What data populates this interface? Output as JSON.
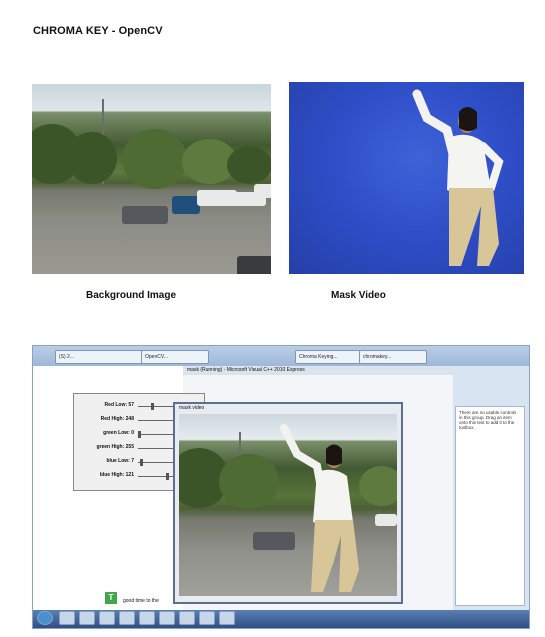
{
  "page": {
    "title": "CHROMA KEY - OpenCV"
  },
  "figures": {
    "background_caption": "Background Image",
    "mask_caption": "Mask Video"
  },
  "screenshot": {
    "browser_tabs": [
      "(S) 2...",
      "OpenCV...",
      "Chroma Keying...",
      "chromakey..."
    ],
    "vs_title": "mask (Running) - Microsoft Visual C++ 2010 Express",
    "slider_labels": [
      "Red Low: 57",
      "Red High: 248",
      "green Low: 0",
      "green High: 255",
      "blue Low: 7",
      "blue High: 121"
    ],
    "slider_levels": [
      0.22,
      0.97,
      0.0,
      1.0,
      0.03,
      0.47
    ],
    "toolbox_text": "There are no usable controls in this group. Drag an item onto this text to add it to the toolbox.",
    "badge_letter": "T",
    "status_text": "good time to the",
    "video_window_title": "mask video"
  },
  "colors": {
    "chroma_blue": "#2f4fc9",
    "taskbar": "#2f4f82"
  }
}
